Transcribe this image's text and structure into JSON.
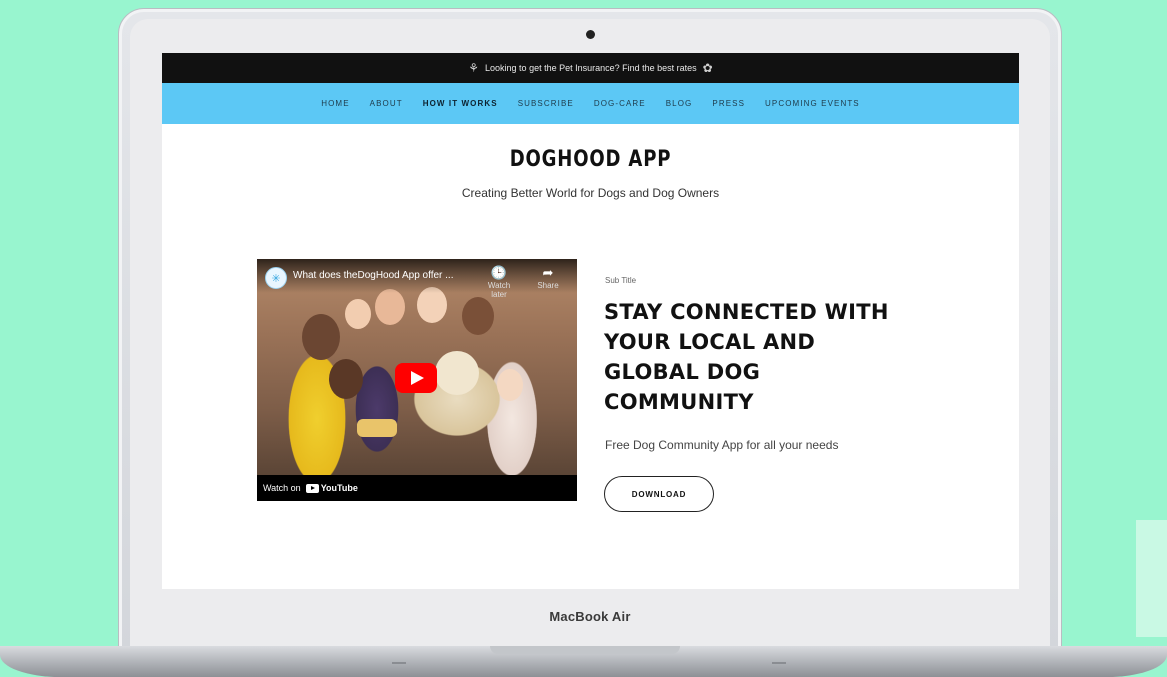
{
  "announcement": {
    "text": "Looking to get the Pet Insurance? Find the best rates",
    "left_glyph": "flower-icon",
    "right_glyph": "flower-icon"
  },
  "nav": {
    "items": [
      {
        "label": "HOME",
        "active": false
      },
      {
        "label": "ABOUT",
        "active": false
      },
      {
        "label": "HOW IT WORKS",
        "active": true
      },
      {
        "label": "SUBSCRIBE",
        "active": false
      },
      {
        "label": "DOG-CARE",
        "active": false
      },
      {
        "label": "BLOG",
        "active": false
      },
      {
        "label": "PRESS",
        "active": false
      },
      {
        "label": "UPCOMING EVENTS",
        "active": false
      }
    ]
  },
  "site": {
    "title": "DOGHOOD APP",
    "subtitle": "Creating Better World for Dogs and Dog Owners"
  },
  "video": {
    "title": "What does theDogHood App offer ...",
    "watch_later_label": "Watch later",
    "share_label": "Share",
    "watch_on": "Watch on",
    "platform": "YouTube"
  },
  "content": {
    "small_subtitle": "Sub Title",
    "headline_lines": [
      "STAY CONNECTED WITH",
      "YOUR LOCAL AND",
      "GLOBAL DOG",
      "COMMUNITY"
    ],
    "tagline": "Free Dog Community App for all your needs",
    "download_label": "DOWNLOAD"
  },
  "device": {
    "label": "MacBook Air"
  },
  "colors": {
    "background": "#98f5cf",
    "nav": "#5cc8f5",
    "announcement": "#111111",
    "play_button": "#ff0000"
  }
}
